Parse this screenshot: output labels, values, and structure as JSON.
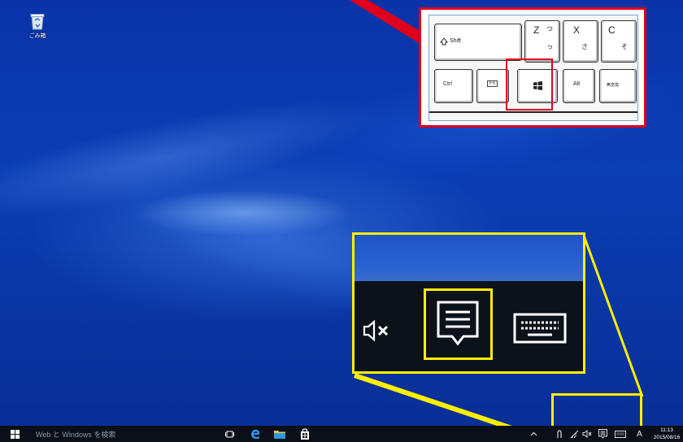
{
  "desktop": {
    "recycle_bin_label": "ごみ箱"
  },
  "keyboard_callout": {
    "keys": {
      "shift": "Shift",
      "z": "Z",
      "z_kana_top": "つ",
      "z_kana_bottom": "っ",
      "x": "X",
      "x_kana": "さ",
      "c": "C",
      "c_kana": "そ",
      "ctrl": "Ctrl",
      "fn": "Fn",
      "alt": "Alt",
      "muhenkan": "無変換"
    },
    "highlight_color": "#e0001b"
  },
  "zoom_callout": {
    "highlight_color": "#ffee00",
    "icons": [
      "speaker-muted-icon",
      "action-center-icon",
      "touch-keyboard-icon"
    ]
  },
  "taskbar": {
    "search_placeholder": "Web と Windows を検索",
    "clock_time": "11:13",
    "clock_date": "2015/08/16",
    "ime_indicator": "A"
  }
}
